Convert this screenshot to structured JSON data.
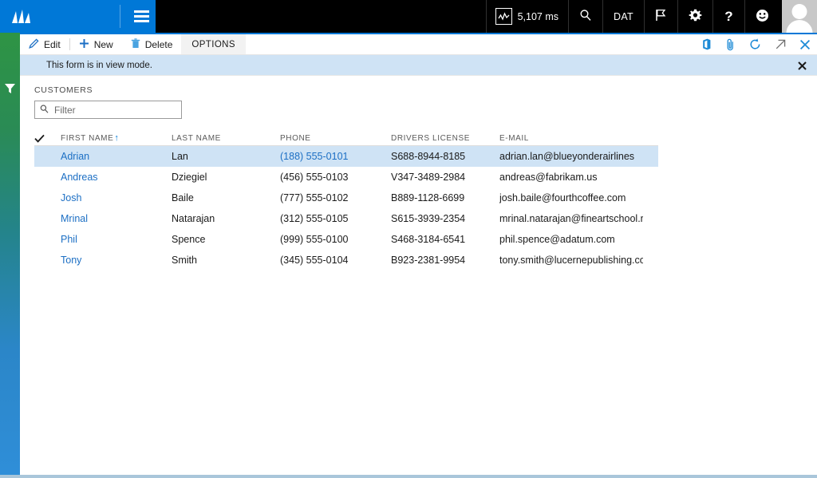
{
  "topbar": {
    "logo_icon": "dynamics-logo-icon",
    "menu_icon": "hamburger-menu-icon",
    "perf": {
      "icon": "performance-monitor-icon",
      "value": "5,107 ms"
    },
    "search_icon": "search-icon",
    "company": "DAT",
    "flag_icon": "flag-icon",
    "settings_icon": "gear-icon",
    "help_icon": "question-mark-icon",
    "feedback_icon": "smiley-face-icon",
    "avatar_icon": "user-avatar-icon"
  },
  "rail": {
    "filter_icon": "funnel-filter-icon"
  },
  "actionbar": {
    "edit_label": "Edit",
    "edit_icon": "pencil-icon",
    "new_label": "New",
    "new_icon": "plus-icon",
    "delete_label": "Delete",
    "delete_icon": "trash-can-icon",
    "options_label": "OPTIONS",
    "right_icons": [
      "office-app-icon",
      "attachment-paperclip-icon",
      "refresh-icon",
      "pop-out-icon",
      "close-icon"
    ]
  },
  "infobar": {
    "message": "This form is in view mode.",
    "close_icon": "close-icon"
  },
  "page": {
    "section_title": "CUSTOMERS"
  },
  "filter": {
    "icon": "search-icon",
    "placeholder": "Filter",
    "value": ""
  },
  "grid": {
    "select_all_icon": "checkmark-icon",
    "sort_arrow": "↑",
    "columns": [
      {
        "key": "first",
        "label": "FIRST NAME",
        "sorted": true
      },
      {
        "key": "last",
        "label": "LAST NAME",
        "sorted": false
      },
      {
        "key": "phone",
        "label": "PHONE",
        "sorted": false
      },
      {
        "key": "license",
        "label": "DRIVERS LICENSE",
        "sorted": false
      },
      {
        "key": "email",
        "label": "E-MAIL",
        "sorted": false
      }
    ],
    "rows": [
      {
        "first": "Adrian",
        "last": "Lan",
        "phone": "(188) 555-0101",
        "license": "S688-8944-8185",
        "email": "adrian.lan@blueyonderairlines",
        "selected": true
      },
      {
        "first": "Andreas",
        "last": "Dziegiel",
        "phone": "(456) 555-0103",
        "license": "V347-3489-2984",
        "email": "andreas@fabrikam.us",
        "selected": false
      },
      {
        "first": "Josh",
        "last": "Baile",
        "phone": "(777) 555-0102",
        "license": "B889-1128-6699",
        "email": "josh.baile@fourthcoffee.com",
        "selected": false
      },
      {
        "first": "Mrinal",
        "last": "Natarajan",
        "phone": "(312) 555-0105",
        "license": "S615-3939-2354",
        "email": "mrinal.natarajan@fineartschool.ne",
        "selected": false
      },
      {
        "first": "Phil",
        "last": "Spence",
        "phone": "(999) 555-0100",
        "license": "S468-3184-6541",
        "email": "phil.spence@adatum.com",
        "selected": false
      },
      {
        "first": "Tony",
        "last": "Smith",
        "phone": "(345) 555-0104",
        "license": "B923-2381-9954",
        "email": "tony.smith@lucernepublishing.cor",
        "selected": false
      }
    ]
  },
  "colors": {
    "brand_blue": "#0078d7",
    "link_blue": "#1c6fc4",
    "selection_blue": "#cfe3f5",
    "topbar_black": "#000000",
    "rail_green": "#2e9444",
    "rail_blue": "#2f8ed8"
  }
}
